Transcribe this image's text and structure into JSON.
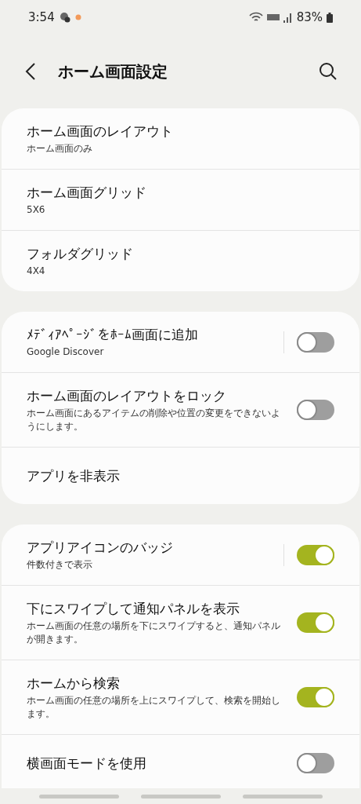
{
  "status_bar": {
    "time": "3:54",
    "battery": "83%"
  },
  "header": {
    "title": "ホーム画面設定"
  },
  "groups": [
    {
      "items": [
        {
          "kind": "nav",
          "title": "ホーム画面のレイアウト",
          "subtitle": "ホーム画面のみ"
        },
        {
          "kind": "nav",
          "title": "ホーム画面グリッド",
          "subtitle": "5X6"
        },
        {
          "kind": "nav",
          "title": "フォルダグリッド",
          "subtitle": "4X4"
        }
      ]
    },
    {
      "items": [
        {
          "kind": "toggle",
          "title": "ﾒﾃﾞｨｱﾍﾟｰｼﾞをﾎｰﾑ画面に追加",
          "subtitle": "Google Discover",
          "on": false,
          "split": true
        },
        {
          "kind": "toggle",
          "title": "ホーム画面のレイアウトをロック",
          "subtitle": "ホーム画面にあるアイテムの削除や位置の変更をできないようにします。",
          "on": false,
          "split": false
        },
        {
          "kind": "nav",
          "title": "アプリを非表示"
        }
      ]
    },
    {
      "items": [
        {
          "kind": "toggle",
          "title": "アプリアイコンのバッジ",
          "subtitle": "件数付きで表示",
          "on": true,
          "split": true
        },
        {
          "kind": "toggle",
          "title": "下にスワイプして通知パネルを表示",
          "subtitle": "ホーム画面の任意の場所を下にスワイプすると、通知パネルが開きます。",
          "on": true,
          "split": false
        },
        {
          "kind": "toggle",
          "title": "ホームから検索",
          "subtitle": "ホーム画面の任意の場所を上にスワイプして、検索を開始します。",
          "on": true,
          "split": false
        },
        {
          "kind": "toggle",
          "title": "横画面モードを使用",
          "on": false,
          "split": false
        }
      ]
    }
  ]
}
